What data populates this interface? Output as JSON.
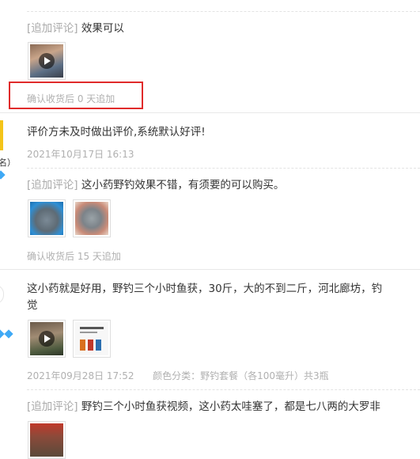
{
  "reviews": [
    {
      "followup_tag": "[追加评论]",
      "followup_text": "效果可以",
      "followup_note": "确认收货后 0 天追加"
    },
    {
      "user_suffix": "名）",
      "text": "评价方未及时做出评价,系统默认好评!",
      "date": "2021年10月17日 16:13",
      "followup_tag": "[追加评论]",
      "followup_text": "这小药野钓效果不错，有须要的可以购买。",
      "followup_note": "确认收货后 15 天追加"
    },
    {
      "text_line1": "这小药就是好用，野钓三个小时鱼获，30斤，大的不到二斤，河北廊坊，钓",
      "text_line2": "觉",
      "date": "2021年09月28日 17:52",
      "sku": "颜色分类：野钓套餐（各100毫升）共3瓶",
      "followup_tag": "[追加评论]",
      "followup_text": "野钓三个小时鱼获视频，这小药太哇塞了，都是七八两的大罗非"
    }
  ],
  "colors": {
    "highlight_border": "#e02b2b",
    "tag_gray": "#aaaaaa",
    "meta_gray": "#b0b0b0",
    "badge_yellow": "#f4c419",
    "diamond_blue": "#3fa9f5"
  },
  "icons": [
    "play-icon",
    "diamond-icon"
  ]
}
